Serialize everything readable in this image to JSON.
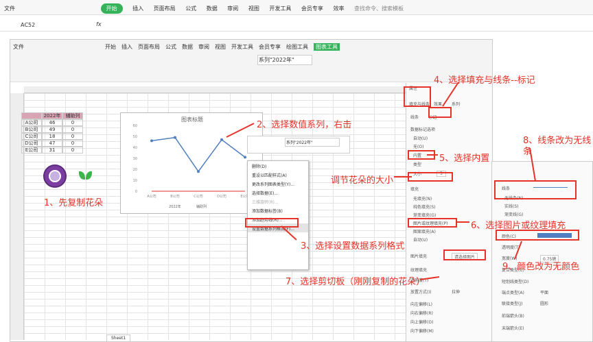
{
  "menu_bar": [
    "文件",
    "开始",
    "插入",
    "页面布局",
    "公式",
    "数据",
    "审阅",
    "视图",
    "开发工具",
    "会员专享",
    "效率"
  ],
  "search": "查找命令、搜索模板",
  "name_box": "A̅C52",
  "fx": "fx",
  "inner_tabs": [
    "文件",
    "开始",
    "插入",
    "页面布局",
    "公式",
    "数据",
    "审阅",
    "视图",
    "开发工具",
    "会员专享",
    "绘图工具",
    "图表工具"
  ],
  "series_select": "系列\"2022年\"",
  "table": {
    "headers": [
      "",
      "2022年",
      "辅助列"
    ],
    "rows": [
      [
        "A公司",
        "46",
        "0"
      ],
      [
        "B公司",
        "49",
        "0"
      ],
      [
        "C公司",
        "18",
        "0"
      ],
      [
        "D公司",
        "47",
        "0"
      ],
      [
        "E公司",
        "31",
        "0"
      ]
    ]
  },
  "chart_data": {
    "type": "line",
    "title": "图表标题",
    "categories": [
      "A公司",
      "B公司",
      "C公司",
      "D公司",
      "E公司"
    ],
    "series": [
      {
        "name": "2022年",
        "values": [
          46,
          49,
          18,
          47,
          31
        ]
      },
      {
        "name": "辅助列",
        "values": [
          0,
          0,
          0,
          0,
          0
        ]
      }
    ],
    "ylim": [
      0,
      60
    ],
    "yticks": [
      "0",
      "10",
      "20",
      "30",
      "40",
      "50",
      "60"
    ]
  },
  "context_menu": [
    "删除(D)",
    "重设以匹配样式(A)",
    "更改系列图表类型(Y)...",
    "选择数据(E)...",
    "三维旋转(R)...",
    "添加数据标签(B)",
    "添加趋势线(R)...",
    "设置数据系列格式(F)..."
  ],
  "panel": {
    "title": "属性",
    "tabs": [
      "填充与线条",
      "效果",
      "系列"
    ],
    "sub": [
      "线条",
      "标记"
    ],
    "section": "数据标记选项",
    "options": [
      "自动(U)",
      "无(O)",
      "内置"
    ],
    "type_lbl": "类型",
    "size_lbl": "大小",
    "size_val": "5",
    "fill": "填充",
    "fills": [
      "无填充(N)",
      "纯色填充(S)",
      "渐变填充(G)",
      "图片或纹理填充(P)",
      "图案填充(A)",
      "自动(U)"
    ],
    "pic_fill": "图片填充",
    "pic_val": "请选择图片",
    "tex": "纹理填充",
    "trans": "透明度(T)",
    "tile": "放置方式(I)",
    "tile_val": "拉伸",
    "offsets": [
      "向左偏移(L)",
      "向右偏移(R)",
      "向上偏移(O)",
      "向下偏移(M)"
    ],
    "offval": "4%"
  },
  "panel2": {
    "line": "线条",
    "opts": [
      "无线条(N)",
      "实线(S)",
      "渐变线(G)"
    ],
    "color": "颜色(C)",
    "trans": "透明度(T)",
    "width": "宽度(W)",
    "width_val": "0.75磅",
    "rows": [
      "复合类型(C)",
      "短划线类型(D)",
      "端点类型(A)",
      "联接类型(J)",
      "前端箭头(B)",
      "末端箭头(E)"
    ],
    "vals": [
      "",
      "",
      "平面",
      "圆形",
      "",
      ""
    ]
  },
  "sheet_tab": "Sheet1",
  "annotations": [
    "1、先复制花朵",
    "2、选择数值系列，右击",
    "3、选择设置数据系列格式",
    "4、选择填充与线条--标记",
    "5、选择内置",
    "6、选择图片或纹理填充",
    "7、选择剪切板（刚刚复制的花朵）",
    "8、线条改为无线条",
    "9、颜色改为无颜色",
    "调节花朵的大小"
  ],
  "colors": {
    "accent": "#34b35a",
    "annotation": "#e63228",
    "series": "#4f7fc0"
  }
}
